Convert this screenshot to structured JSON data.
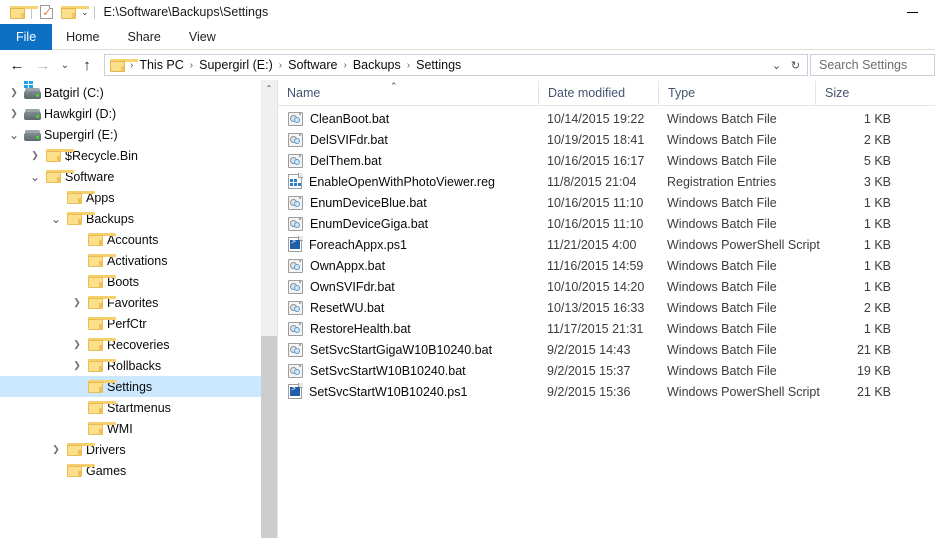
{
  "window": {
    "title_path": "E:\\Software\\Backups\\Settings",
    "minimize_label": "–"
  },
  "quick_access": {
    "folder_icon": "folder-icon",
    "properties_icon": "properties-checkmark-icon",
    "new_folder_icon": "new-folder-icon",
    "customize_caret": "⌄"
  },
  "ribbon": {
    "tabs": [
      {
        "label": "File",
        "active": true
      },
      {
        "label": "Home",
        "active": false
      },
      {
        "label": "Share",
        "active": false
      },
      {
        "label": "View",
        "active": false
      }
    ]
  },
  "address_bar": {
    "back_icon": "←",
    "forward_icon": "→",
    "recent_icon": "⌄",
    "up_icon": "↑",
    "crumbs": [
      "This PC",
      "Supergirl (E:)",
      "Software",
      "Backups",
      "Settings"
    ],
    "separator": "›",
    "dropdown_icon": "⌄",
    "refresh_icon": "↻",
    "search_placeholder": "Search Settings"
  },
  "sidebar": {
    "items": [
      {
        "label": "Batgirl (C:)",
        "indent": 1,
        "chev": "collapsed",
        "icon": "system-drive-icon",
        "selected": false
      },
      {
        "label": "Hawkgirl (D:)",
        "indent": 1,
        "chev": "collapsed",
        "icon": "drive-icon",
        "selected": false
      },
      {
        "label": "Supergirl (E:)",
        "indent": 1,
        "chev": "expanded",
        "icon": "drive-icon",
        "selected": false
      },
      {
        "label": "$Recycle.Bin",
        "indent": 2,
        "chev": "collapsed",
        "icon": "folder-icon",
        "selected": false
      },
      {
        "label": "Software",
        "indent": 2,
        "chev": "expanded",
        "icon": "folder-icon",
        "selected": false
      },
      {
        "label": "Apps",
        "indent": 3,
        "chev": "none",
        "icon": "folder-icon",
        "selected": false
      },
      {
        "label": "Backups",
        "indent": 3,
        "chev": "expanded",
        "icon": "folder-icon",
        "selected": false
      },
      {
        "label": "Accounts",
        "indent": 4,
        "chev": "none",
        "icon": "folder-icon",
        "selected": false
      },
      {
        "label": "Activations",
        "indent": 4,
        "chev": "none",
        "icon": "folder-icon",
        "selected": false
      },
      {
        "label": "Boots",
        "indent": 4,
        "chev": "none",
        "icon": "folder-icon",
        "selected": false
      },
      {
        "label": "Favorites",
        "indent": 4,
        "chev": "collapsed",
        "icon": "folder-icon",
        "selected": false
      },
      {
        "label": "PerfCtr",
        "indent": 4,
        "chev": "none",
        "icon": "folder-icon",
        "selected": false
      },
      {
        "label": "Recoveries",
        "indent": 4,
        "chev": "collapsed",
        "icon": "folder-icon",
        "selected": false
      },
      {
        "label": "Rollbacks",
        "indent": 4,
        "chev": "collapsed",
        "icon": "folder-icon",
        "selected": false
      },
      {
        "label": "Settings",
        "indent": 4,
        "chev": "none",
        "icon": "folder-icon",
        "selected": true
      },
      {
        "label": "Startmenus",
        "indent": 4,
        "chev": "none",
        "icon": "folder-icon",
        "selected": false
      },
      {
        "label": "WMI",
        "indent": 4,
        "chev": "none",
        "icon": "folder-icon",
        "selected": false
      },
      {
        "label": "Drivers",
        "indent": 3,
        "chev": "collapsed",
        "icon": "folder-icon",
        "selected": false
      },
      {
        "label": "Games",
        "indent": 3,
        "chev": "none",
        "icon": "folder-icon",
        "selected": false
      }
    ],
    "scroll_up_icon": "⌃"
  },
  "file_list": {
    "columns": [
      {
        "key": "name",
        "label": "Name"
      },
      {
        "key": "date",
        "label": "Date modified"
      },
      {
        "key": "type",
        "label": "Type"
      },
      {
        "key": "size",
        "label": "Size"
      }
    ],
    "sort_indicator": "⌃",
    "sort_column": "Name",
    "sort_direction": "ascending",
    "rows": [
      {
        "name": "CleanBoot.bat",
        "date": "10/14/2015 19:22",
        "type": "Windows Batch File",
        "size": "1 KB",
        "icon": "bat-file-icon"
      },
      {
        "name": "DelSVIFdr.bat",
        "date": "10/19/2015 18:41",
        "type": "Windows Batch File",
        "size": "2 KB",
        "icon": "bat-file-icon"
      },
      {
        "name": "DelThem.bat",
        "date": "10/16/2015 16:17",
        "type": "Windows Batch File",
        "size": "5 KB",
        "icon": "bat-file-icon"
      },
      {
        "name": "EnableOpenWithPhotoViewer.reg",
        "date": "11/8/2015 21:04",
        "type": "Registration Entries",
        "size": "3 KB",
        "icon": "reg-file-icon"
      },
      {
        "name": "EnumDeviceBlue.bat",
        "date": "10/16/2015 11:10",
        "type": "Windows Batch File",
        "size": "1 KB",
        "icon": "bat-file-icon"
      },
      {
        "name": "EnumDeviceGiga.bat",
        "date": "10/16/2015 11:10",
        "type": "Windows Batch File",
        "size": "1 KB",
        "icon": "bat-file-icon"
      },
      {
        "name": "ForeachAppx.ps1",
        "date": "11/21/2015 4:00",
        "type": "Windows PowerShell Script",
        "size": "1 KB",
        "icon": "ps1-file-icon"
      },
      {
        "name": "OwnAppx.bat",
        "date": "11/16/2015 14:59",
        "type": "Windows Batch File",
        "size": "1 KB",
        "icon": "bat-file-icon"
      },
      {
        "name": "OwnSVIFdr.bat",
        "date": "10/10/2015 14:20",
        "type": "Windows Batch File",
        "size": "1 KB",
        "icon": "bat-file-icon"
      },
      {
        "name": "ResetWU.bat",
        "date": "10/13/2015 16:33",
        "type": "Windows Batch File",
        "size": "2 KB",
        "icon": "bat-file-icon"
      },
      {
        "name": "RestoreHealth.bat",
        "date": "11/17/2015 21:31",
        "type": "Windows Batch File",
        "size": "1 KB",
        "icon": "bat-file-icon"
      },
      {
        "name": "SetSvcStartGigaW10B10240.bat",
        "date": "9/2/2015 14:43",
        "type": "Windows Batch File",
        "size": "21 KB",
        "icon": "bat-file-icon"
      },
      {
        "name": "SetSvcStartW10B10240.bat",
        "date": "9/2/2015 15:37",
        "type": "Windows Batch File",
        "size": "19 KB",
        "icon": "bat-file-icon"
      },
      {
        "name": "SetSvcStartW10B10240.ps1",
        "date": "9/2/2015 15:36",
        "type": "Windows PowerShell Script",
        "size": "21 KB",
        "icon": "ps1-file-icon"
      }
    ]
  },
  "colors": {
    "accent": "#0c70c4",
    "selection": "#cce8ff",
    "header_text": "#44546f",
    "folder": "#fcdf8a"
  }
}
